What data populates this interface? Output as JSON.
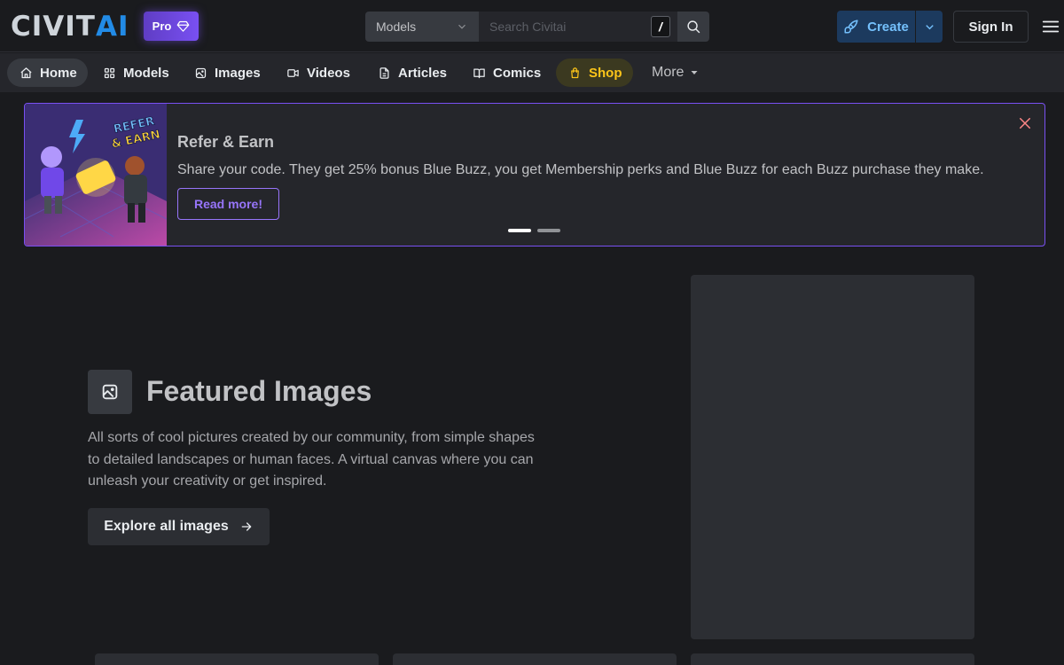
{
  "header": {
    "logo_left": "CIVIT",
    "logo_right": "AI",
    "pro_label": "Pro",
    "search": {
      "category": "Models",
      "placeholder": "Search Civitai",
      "shortcut": "/"
    },
    "create_label": "Create",
    "signin_label": "Sign In"
  },
  "nav": {
    "items": [
      {
        "label": "Home",
        "icon": "home-icon"
      },
      {
        "label": "Models",
        "icon": "grid-icon"
      },
      {
        "label": "Images",
        "icon": "photo-icon"
      },
      {
        "label": "Videos",
        "icon": "video-icon"
      },
      {
        "label": "Articles",
        "icon": "file-text-icon"
      },
      {
        "label": "Comics",
        "icon": "book-icon"
      },
      {
        "label": "Shop",
        "icon": "shopping-bag-icon"
      }
    ],
    "more_label": "More"
  },
  "banner": {
    "title": "Refer & Earn",
    "text": "Share your code. They get 25% bonus Blue Buzz, you get Membership perks and Blue Buzz for each Buzz purchase they make.",
    "button_label": "Read more!",
    "image_text_1": "REFER",
    "image_text_2": "& EARN"
  },
  "featured": {
    "title": "Featured Images",
    "description": "All sorts of cool pictures created by our community, from simple shapes to detailed landscapes or human faces. A virtual canvas where you can unleash your creativity or get inspired.",
    "button_label": "Explore all images"
  },
  "colors": {
    "background": "#1a1b1e",
    "accent_purple": "#7950f2",
    "shop_yellow": "#fcc419",
    "create_blue": "#74c0fc"
  }
}
